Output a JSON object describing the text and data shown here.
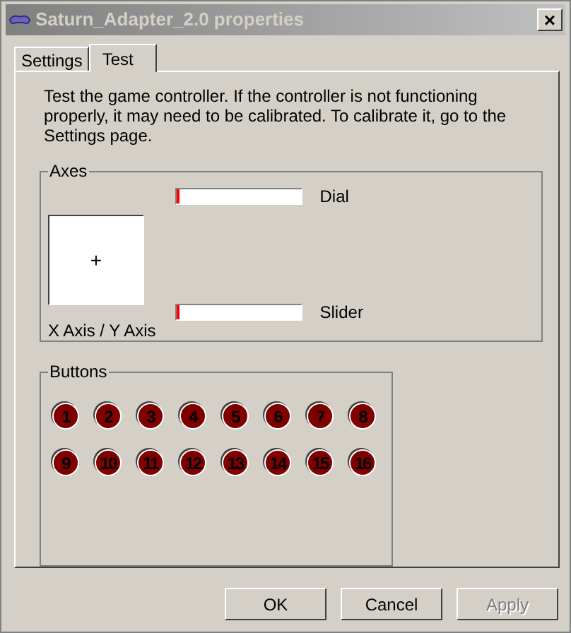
{
  "window": {
    "title": "Saturn_Adapter_2.0 properties",
    "close": "×"
  },
  "tabs": [
    {
      "label": "Settings",
      "selected": false
    },
    {
      "label": "Test",
      "selected": true
    }
  ],
  "intro": "Test the game controller.  If the controller is not functioning properly, it may need to be calibrated.  To calibrate it, go to the Settings page.",
  "axes": {
    "title": "Axes",
    "xy_label": "X Axis / Y Axis",
    "cursor": "+",
    "meters": [
      {
        "label": "Dial",
        "level": 0.02
      },
      {
        "label": "Slider",
        "level": 0.02
      }
    ]
  },
  "buttons_group": {
    "title": "Buttons",
    "buttons": [
      {
        "label": "1",
        "pressed": false
      },
      {
        "label": "2",
        "pressed": false
      },
      {
        "label": "3",
        "pressed": false
      },
      {
        "label": "4",
        "pressed": false
      },
      {
        "label": "5",
        "pressed": false
      },
      {
        "label": "6",
        "pressed": false
      },
      {
        "label": "7",
        "pressed": false
      },
      {
        "label": "8",
        "pressed": false
      },
      {
        "label": "9",
        "pressed": false
      },
      {
        "label": "10",
        "pressed": false
      },
      {
        "label": "11",
        "pressed": false
      },
      {
        "label": "12",
        "pressed": false
      },
      {
        "label": "13",
        "pressed": false
      },
      {
        "label": "14",
        "pressed": false
      },
      {
        "label": "15",
        "pressed": false
      },
      {
        "label": "16",
        "pressed": false
      }
    ]
  },
  "footer": [
    {
      "label": "OK",
      "disabled": false
    },
    {
      "label": "Cancel",
      "disabled": false
    },
    {
      "label": "Apply",
      "disabled": true
    }
  ]
}
